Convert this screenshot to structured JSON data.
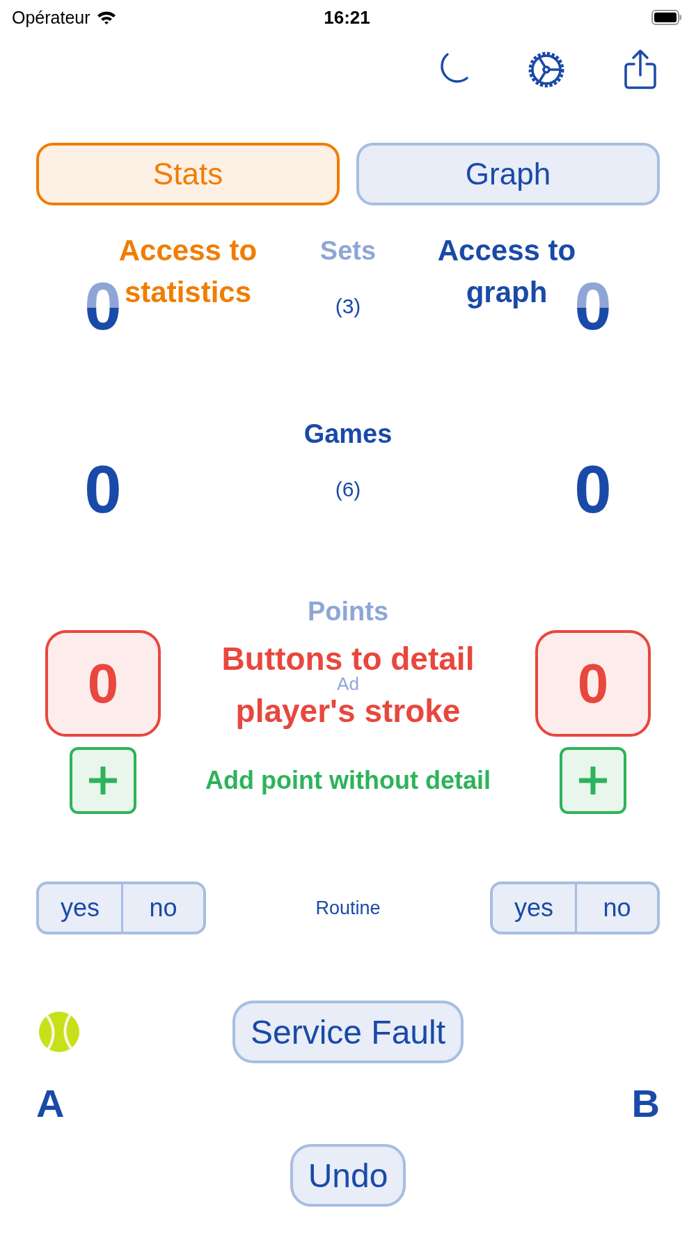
{
  "status_bar": {
    "carrier": "Opérateur",
    "time": "16:21"
  },
  "tabs": [
    {
      "label": "Stats",
      "selected": true
    },
    {
      "label": "Graph",
      "selected": false
    }
  ],
  "rows": [
    {
      "kind": "score",
      "label": "Sets",
      "dimmed": true,
      "info": "(3)",
      "info_dimmed": false,
      "score_a": "0",
      "score_b": "0"
    },
    {
      "kind": "score",
      "label": "Games",
      "dimmed": false,
      "info": "(6)",
      "info_dimmed": false,
      "score_a": "0",
      "score_b": "0"
    },
    {
      "kind": "buttons",
      "label": "Points",
      "dimmed": true,
      "info": "Ad",
      "info_dimmed": true,
      "score_a": "0",
      "score_b": "0"
    }
  ],
  "annotations": [
    {
      "lines": [
        "Access to",
        "statistics"
      ],
      "color": "#f07d00"
    },
    {
      "lines": [
        "Access to",
        "graph"
      ],
      "color": "#1a4aa8"
    },
    {
      "lines": [
        "Buttons to detail",
        "player's stroke"
      ],
      "color": "#e8473e"
    },
    {
      "lines": [
        "Add point without detail"
      ],
      "color": "#2db35a"
    }
  ],
  "routine": {
    "label": "Routine",
    "a": [
      {
        "label": "yes",
        "selected": false
      },
      {
        "label": "no",
        "selected": false
      }
    ],
    "b": [
      {
        "label": "yes",
        "selected": false
      },
      {
        "label": "no",
        "selected": false
      }
    ]
  },
  "service_button": "Service Fault",
  "players": [
    {
      "name": "A",
      "serving": true
    },
    {
      "name": "B",
      "serving": false
    }
  ],
  "undo": "Undo"
}
